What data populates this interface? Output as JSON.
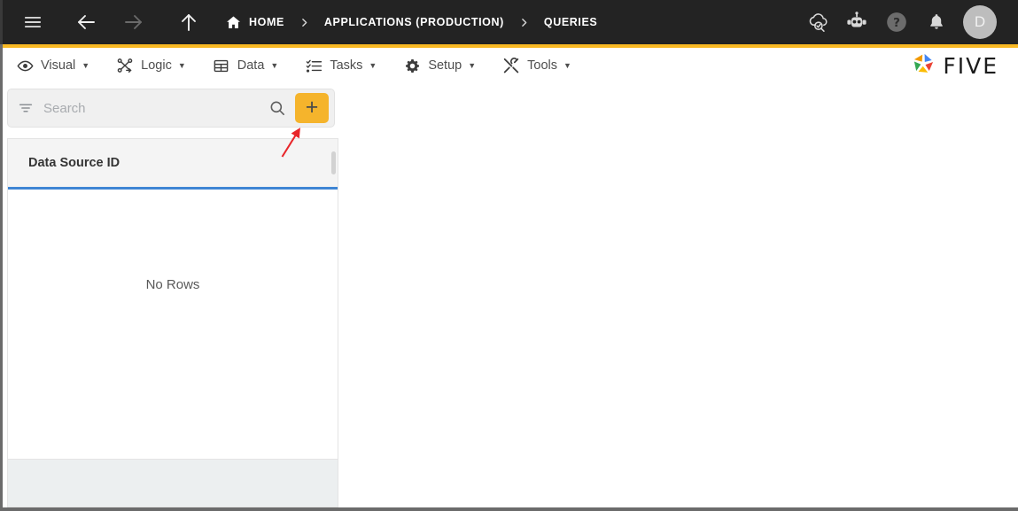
{
  "topbar": {
    "menu_icon": "hamburger-menu-icon",
    "back_icon": "arrow-left-icon",
    "forward_icon": "arrow-right-icon",
    "up_icon": "arrow-up-icon",
    "breadcrumb": [
      {
        "label": "HOME",
        "icon": "home-icon"
      },
      {
        "label": "APPLICATIONS (PRODUCTION)",
        "icon": ""
      },
      {
        "label": "QUERIES",
        "icon": ""
      }
    ],
    "separator": "›",
    "actions": [
      {
        "name": "cloud-check-icon",
        "title": "Deploy"
      },
      {
        "name": "robot-icon",
        "title": "Assistant"
      },
      {
        "name": "help-icon",
        "title": "Help"
      },
      {
        "name": "bell-icon",
        "title": "Notifications"
      }
    ],
    "avatar_initial": "D"
  },
  "menubar": {
    "items": [
      {
        "label": "Visual",
        "icon": "eye-icon",
        "caret": "▼"
      },
      {
        "label": "Logic",
        "icon": "logic-graph-icon",
        "caret": "▼"
      },
      {
        "label": "Data",
        "icon": "table-grid-icon",
        "caret": "▼"
      },
      {
        "label": "Tasks",
        "icon": "checklist-icon",
        "caret": "▼"
      },
      {
        "label": "Setup",
        "icon": "gear-icon",
        "caret": "▼"
      },
      {
        "label": "Tools",
        "icon": "tools-icon",
        "caret": "▼"
      }
    ],
    "brand": {
      "text": "FIVE",
      "logo_icon": "five-pinwheel-logo"
    }
  },
  "search": {
    "filter_icon": "filter-icon",
    "placeholder": "Search",
    "value": "",
    "search_icon": "search-icon",
    "add_label": "+",
    "add_icon": "plus-icon"
  },
  "grid": {
    "columns": [
      "Data Source ID"
    ],
    "rows": [],
    "empty_message": "No Rows"
  },
  "annotation": {
    "arrow_color": "#e8262a",
    "points_to": "add-button"
  },
  "colors": {
    "topbar_bg": "#232323",
    "accent_yellow": "#f9b924",
    "add_button": "#f5b42c",
    "grid_header_underline": "#3f85d4",
    "grid_footer": "#eceff0"
  }
}
